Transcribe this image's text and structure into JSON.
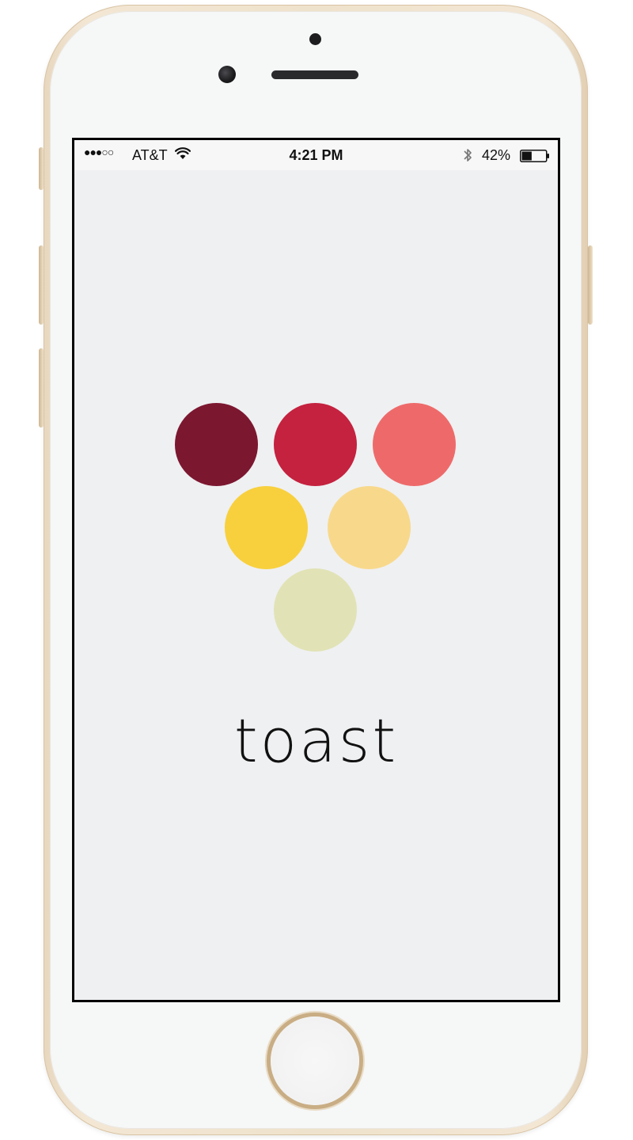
{
  "status_bar": {
    "signal_dots": "●●●○○",
    "carrier": "AT&T",
    "time": "4:21 PM",
    "battery_percent": "42%",
    "battery_level": 0.42
  },
  "app": {
    "name": "toast",
    "logo_colors": [
      "#7c1730",
      "#c4223f",
      "#ee6a6a",
      "#f8d03d",
      "#f8d98c",
      "#e1e3b6"
    ]
  },
  "icons": {
    "wifi": "wifi-icon",
    "bluetooth": "bluetooth-icon",
    "battery": "battery-icon"
  }
}
